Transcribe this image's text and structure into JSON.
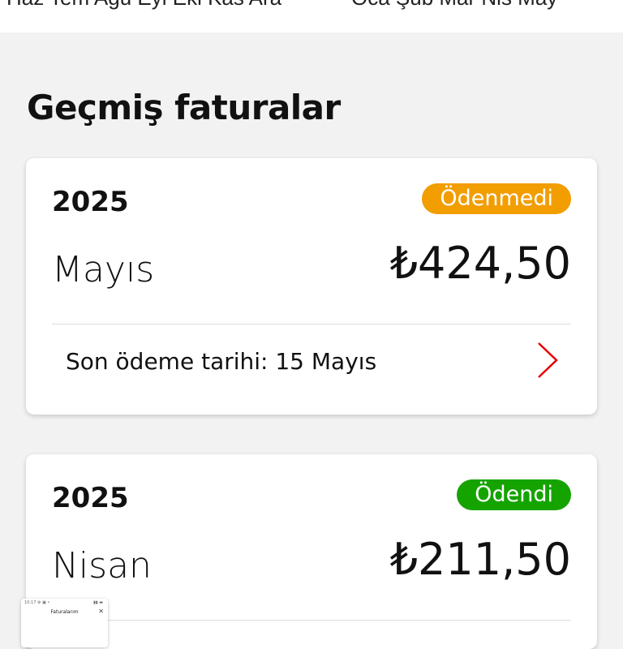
{
  "top_strip": {
    "months_left": "Haz Tem Ağu Eyl Eki Kas Ara",
    "months_right": "Oca Şub Mar Nis May"
  },
  "section_title": "Geçmiş faturalar",
  "bills": [
    {
      "year": "2025",
      "status": "Ödenmedi",
      "status_color": "#f29d00",
      "month": "Mayıs",
      "amount": "₺424,50",
      "due_text": "Son ödeme tarihi: 15 Mayıs",
      "chevron_color": "#e60000"
    },
    {
      "year": "2025",
      "status": "Ödendi",
      "status_color": "#15a300",
      "month": "Nisan",
      "amount": "₺211,50"
    }
  ],
  "thumbnail": {
    "status_left": "10:17 ⚙ ▣ •",
    "status_right": "▮▮ ▬",
    "title": "Faturalarım",
    "close": "✕"
  }
}
